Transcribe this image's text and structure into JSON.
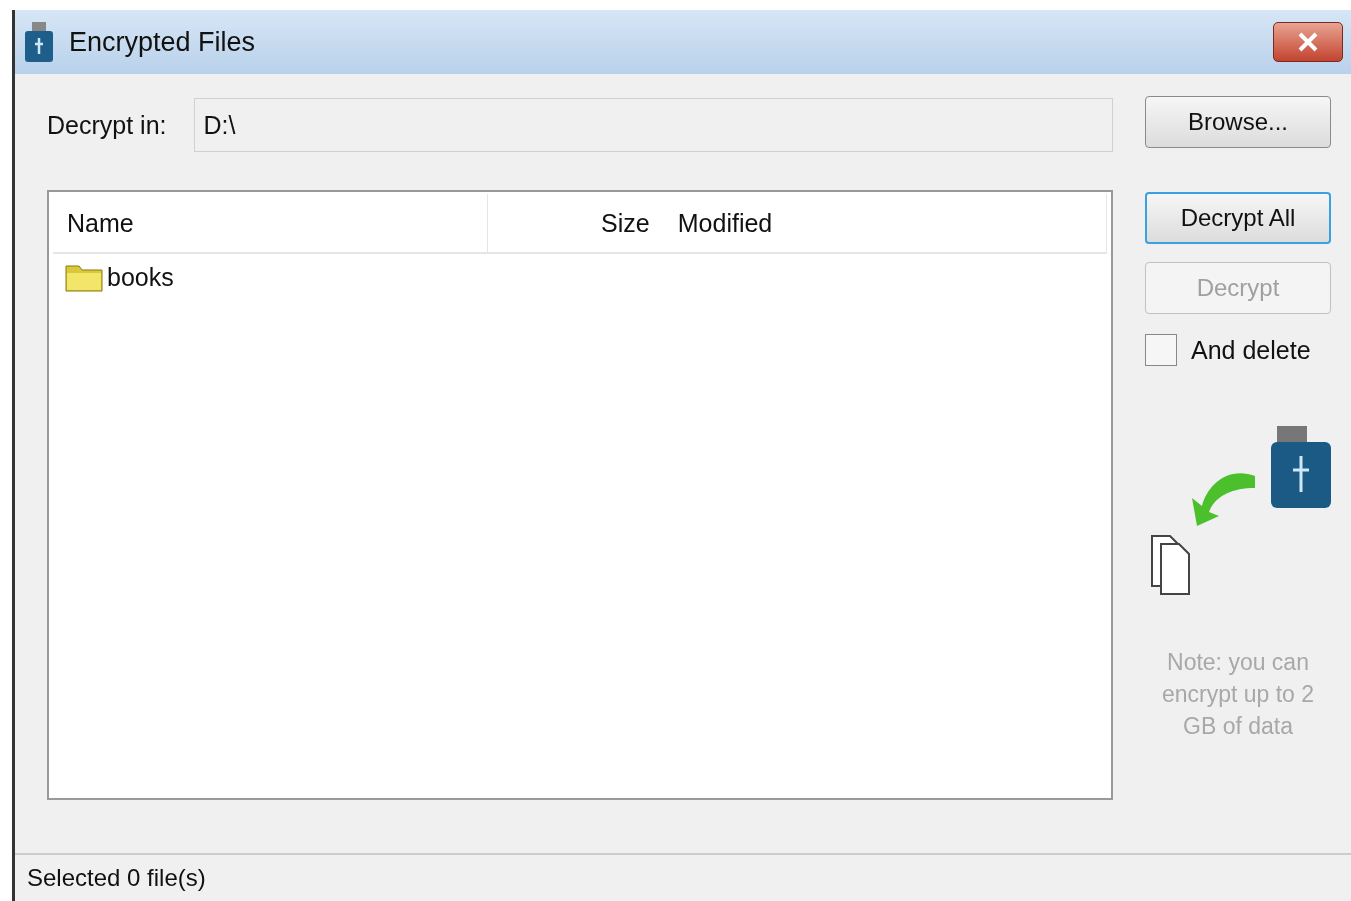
{
  "window": {
    "title": "Encrypted Files"
  },
  "decrypt_in": {
    "label": "Decrypt in:",
    "value": "D:\\"
  },
  "table": {
    "columns": [
      "Name",
      "Size",
      "Modified"
    ],
    "rows": [
      {
        "kind": "folder",
        "name": "books"
      }
    ]
  },
  "buttons": [
    {
      "label": "Browse...",
      "disabled": false,
      "focused": false
    },
    {
      "label": "Decrypt All",
      "disabled": false,
      "focused": true
    },
    {
      "label": "Decrypt",
      "disabled": true,
      "focused": false
    }
  ],
  "and_delete": {
    "label": "And delete",
    "checked": false
  },
  "note": "Note: you can encrypt up to 2 GB of data",
  "status_bar": "Selected 0 file(s)"
}
